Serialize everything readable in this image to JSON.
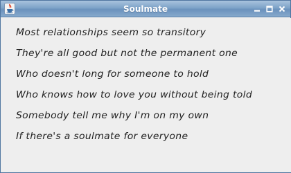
{
  "window": {
    "title": "Soulmate",
    "app_icon": "java-cup-icon",
    "controls": [
      "minimize-icon",
      "maximize-icon",
      "close-icon"
    ]
  },
  "lyrics": [
    "Most relationships seem so transitory",
    "They're all good but not the permanent one",
    "Who doesn't long for someone to hold",
    "Who knows how to love you without being told",
    "Somebody tell me why I'm on my own",
    "If there's a soulmate for everyone"
  ],
  "colors": {
    "titlebar": "#7ea3c9",
    "background": "#eeeeee",
    "text": "#222222"
  }
}
